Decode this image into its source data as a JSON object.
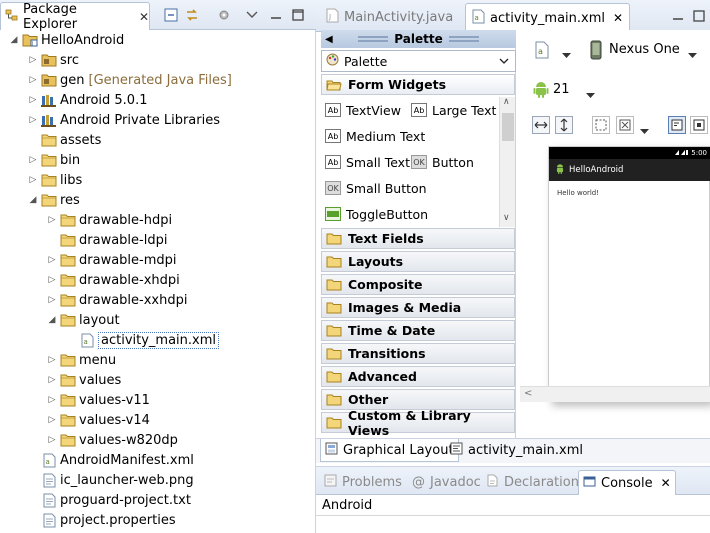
{
  "package_explorer": {
    "tab_title": "Package Explorer",
    "close": "✕",
    "tree": [
      {
        "label": "HelloAndroid",
        "indent": 0,
        "arrow": "◢",
        "icon": "project-icon"
      },
      {
        "label": "src",
        "indent": 1,
        "arrow": "▷",
        "icon": "source-folder-icon"
      },
      {
        "label": "gen",
        "deco": "[Generated Java Files]",
        "indent": 1,
        "arrow": "▷",
        "icon": "source-folder-icon"
      },
      {
        "label": "Android 5.0.1",
        "indent": 1,
        "arrow": "▷",
        "icon": "library-icon"
      },
      {
        "label": "Android Private Libraries",
        "indent": 1,
        "arrow": "▷",
        "icon": "library-icon"
      },
      {
        "label": "assets",
        "indent": 1,
        "arrow": "",
        "icon": "folder-icon"
      },
      {
        "label": "bin",
        "indent": 1,
        "arrow": "▷",
        "icon": "folder-icon"
      },
      {
        "label": "libs",
        "indent": 1,
        "arrow": "▷",
        "icon": "folder-icon"
      },
      {
        "label": "res",
        "indent": 1,
        "arrow": "◢",
        "icon": "folder-icon"
      },
      {
        "label": "drawable-hdpi",
        "indent": 2,
        "arrow": "▷",
        "icon": "folder-icon"
      },
      {
        "label": "drawable-ldpi",
        "indent": 2,
        "arrow": "",
        "icon": "folder-icon"
      },
      {
        "label": "drawable-mdpi",
        "indent": 2,
        "arrow": "▷",
        "icon": "folder-icon"
      },
      {
        "label": "drawable-xhdpi",
        "indent": 2,
        "arrow": "▷",
        "icon": "folder-icon"
      },
      {
        "label": "drawable-xxhdpi",
        "indent": 2,
        "arrow": "▷",
        "icon": "folder-icon"
      },
      {
        "label": "layout",
        "indent": 2,
        "arrow": "◢",
        "icon": "folder-icon"
      },
      {
        "label": "activity_main.xml",
        "indent": 3,
        "arrow": "",
        "icon": "xml-file-icon",
        "selected": true
      },
      {
        "label": "menu",
        "indent": 2,
        "arrow": "▷",
        "icon": "folder-icon"
      },
      {
        "label": "values",
        "indent": 2,
        "arrow": "▷",
        "icon": "folder-icon"
      },
      {
        "label": "values-v11",
        "indent": 2,
        "arrow": "▷",
        "icon": "folder-icon"
      },
      {
        "label": "values-v14",
        "indent": 2,
        "arrow": "▷",
        "icon": "folder-icon"
      },
      {
        "label": "values-w820dp",
        "indent": 2,
        "arrow": "▷",
        "icon": "folder-icon"
      },
      {
        "label": "AndroidManifest.xml",
        "indent": 1,
        "arrow": "",
        "icon": "xml-file-icon"
      },
      {
        "label": "ic_launcher-web.png",
        "indent": 1,
        "arrow": "",
        "icon": "file-icon"
      },
      {
        "label": "proguard-project.txt",
        "indent": 1,
        "arrow": "",
        "icon": "file-icon"
      },
      {
        "label": "project.properties",
        "indent": 1,
        "arrow": "",
        "icon": "file-icon"
      }
    ]
  },
  "editor": {
    "tabs": [
      {
        "label": "MainActivity.java",
        "active": false
      },
      {
        "label": "activity_main.xml",
        "active": true
      }
    ],
    "close": "✕",
    "palette": {
      "header": "Palette",
      "combo": "Palette",
      "open_category": "Form Widgets",
      "widgets": [
        [
          {
            "label": "TextView",
            "icon": "Ab"
          },
          {
            "label": "Large Text",
            "icon": "Ab"
          }
        ],
        [
          {
            "label": "Medium Text",
            "icon": "Ab"
          }
        ],
        [
          {
            "label": "Small Text",
            "icon": "Ab"
          },
          {
            "label": "Button",
            "icon": "OK"
          }
        ],
        [
          {
            "label": "Small Button",
            "icon": "OK"
          }
        ],
        [
          {
            "label": "ToggleButton",
            "icon": "toggle"
          }
        ]
      ],
      "categories": [
        "Text Fields",
        "Layouts",
        "Composite",
        "Images & Media",
        "Time & Date",
        "Transitions",
        "Advanced",
        "Other",
        "Custom & Library Views"
      ]
    },
    "toolbar": {
      "device": "Nexus One",
      "api_level": "21"
    },
    "device_preview": {
      "time": "5:00",
      "app_title": "HelloAndroid",
      "content_text": "Hello world!"
    },
    "bottom_tabs": [
      {
        "label": "Graphical Layout",
        "active": true
      },
      {
        "label": "activity_main.xml",
        "active": false
      }
    ]
  },
  "console_view": {
    "tabs": [
      {
        "label": "Problems",
        "active": false
      },
      {
        "label": "Javadoc",
        "active": false
      },
      {
        "label": "Declaration",
        "active": false
      },
      {
        "label": "Console",
        "active": true
      }
    ],
    "close": "✕",
    "content": "Android"
  },
  "colors": {
    "folder": "#e8c15a",
    "android_green": "#8bc34a",
    "selection_border": "#4a7bc0",
    "tab_border": "#b7c3d6"
  }
}
